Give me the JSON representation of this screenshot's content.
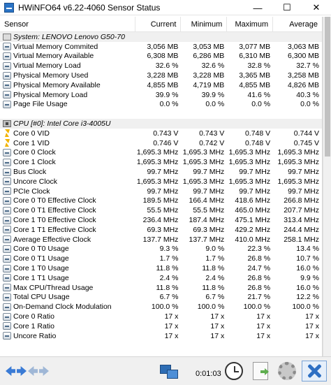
{
  "window": {
    "title": "HWiNFO64 v6.22-4060 Sensor Status",
    "controls": {
      "minimize": "—",
      "maximize": "☐",
      "close": "✕"
    }
  },
  "columns": {
    "sensor": "Sensor",
    "current": "Current",
    "minimum": "Minimum",
    "maximum": "Maximum",
    "average": "Average"
  },
  "rows": [
    {
      "type": "group",
      "icon": "system-icon",
      "label": "System: LENOVO Lenovo G50-70"
    },
    {
      "type": "data",
      "icon": "sensor-icon",
      "label": "Virtual Memory Commited",
      "cur": "3,056 MB",
      "min": "3,053 MB",
      "max": "3,077 MB",
      "avg": "3,063 MB"
    },
    {
      "type": "data",
      "icon": "sensor-icon",
      "label": "Virtual Memory Available",
      "cur": "6,308 MB",
      "min": "6,286 MB",
      "max": "6,310 MB",
      "avg": "6,300 MB"
    },
    {
      "type": "data",
      "icon": "sensor-icon",
      "label": "Virtual Memory Load",
      "cur": "32.6 %",
      "min": "32.6 %",
      "max": "32.8 %",
      "avg": "32.7 %"
    },
    {
      "type": "data",
      "icon": "sensor-icon",
      "label": "Physical Memory Used",
      "cur": "3,228 MB",
      "min": "3,228 MB",
      "max": "3,365 MB",
      "avg": "3,258 MB"
    },
    {
      "type": "data",
      "icon": "sensor-icon",
      "label": "Physical Memory Available",
      "cur": "4,855 MB",
      "min": "4,719 MB",
      "max": "4,855 MB",
      "avg": "4,826 MB"
    },
    {
      "type": "data",
      "icon": "sensor-icon",
      "label": "Physical Memory Load",
      "cur": "39.9 %",
      "min": "39.9 %",
      "max": "41.6 %",
      "avg": "40.3 %"
    },
    {
      "type": "data",
      "icon": "sensor-icon",
      "label": "Page File Usage",
      "cur": "0.0 %",
      "min": "0.0 %",
      "max": "0.0 %",
      "avg": "0.0 %"
    },
    {
      "type": "spacer"
    },
    {
      "type": "group",
      "icon": "cpu-icon",
      "label": "CPU [#0]: Intel Core i3-4005U"
    },
    {
      "type": "data",
      "icon": "voltage-icon",
      "label": "Core 0 VID",
      "cur": "0.743 V",
      "min": "0.743 V",
      "max": "0.748 V",
      "avg": "0.744 V"
    },
    {
      "type": "data",
      "icon": "voltage-icon",
      "label": "Core 1 VID",
      "cur": "0.746 V",
      "min": "0.742 V",
      "max": "0.748 V",
      "avg": "0.745 V"
    },
    {
      "type": "data",
      "icon": "sensor-icon",
      "label": "Core 0 Clock",
      "cur": "1,695.3 MHz",
      "min": "1,695.3 MHz",
      "max": "1,695.3 MHz",
      "avg": "1,695.3 MHz"
    },
    {
      "type": "data",
      "icon": "sensor-icon",
      "label": "Core 1 Clock",
      "cur": "1,695.3 MHz",
      "min": "1,695.3 MHz",
      "max": "1,695.3 MHz",
      "avg": "1,695.3 MHz"
    },
    {
      "type": "data",
      "icon": "sensor-icon",
      "label": "Bus Clock",
      "cur": "99.7 MHz",
      "min": "99.7 MHz",
      "max": "99.7 MHz",
      "avg": "99.7 MHz"
    },
    {
      "type": "data",
      "icon": "sensor-icon",
      "label": "Uncore Clock",
      "cur": "1,695.3 MHz",
      "min": "1,695.3 MHz",
      "max": "1,695.3 MHz",
      "avg": "1,695.3 MHz"
    },
    {
      "type": "data",
      "icon": "sensor-icon",
      "label": "PCIe Clock",
      "cur": "99.7 MHz",
      "min": "99.7 MHz",
      "max": "99.7 MHz",
      "avg": "99.7 MHz"
    },
    {
      "type": "data",
      "icon": "sensor-icon",
      "label": "Core 0 T0 Effective Clock",
      "cur": "189.5 MHz",
      "min": "166.4 MHz",
      "max": "418.6 MHz",
      "avg": "266.8 MHz"
    },
    {
      "type": "data",
      "icon": "sensor-icon",
      "label": "Core 0 T1 Effective Clock",
      "cur": "55.5 MHz",
      "min": "55.5 MHz",
      "max": "465.0 MHz",
      "avg": "207.7 MHz"
    },
    {
      "type": "data",
      "icon": "sensor-icon",
      "label": "Core 1 T0 Effective Clock",
      "cur": "236.4 MHz",
      "min": "187.4 MHz",
      "max": "475.1 MHz",
      "avg": "313.4 MHz"
    },
    {
      "type": "data",
      "icon": "sensor-icon",
      "label": "Core 1 T1 Effective Clock",
      "cur": "69.3 MHz",
      "min": "69.3 MHz",
      "max": "429.2 MHz",
      "avg": "244.4 MHz"
    },
    {
      "type": "data",
      "icon": "sensor-icon",
      "label": "Average Effective Clock",
      "cur": "137.7 MHz",
      "min": "137.7 MHz",
      "max": "410.0 MHz",
      "avg": "258.1 MHz"
    },
    {
      "type": "data",
      "icon": "sensor-icon",
      "label": "Core 0 T0 Usage",
      "cur": "9.3 %",
      "min": "9.0 %",
      "max": "22.3 %",
      "avg": "13.4 %"
    },
    {
      "type": "data",
      "icon": "sensor-icon",
      "label": "Core 0 T1 Usage",
      "cur": "1.7 %",
      "min": "1.7 %",
      "max": "26.8 %",
      "avg": "10.7 %"
    },
    {
      "type": "data",
      "icon": "sensor-icon",
      "label": "Core 1 T0 Usage",
      "cur": "11.8 %",
      "min": "11.8 %",
      "max": "24.7 %",
      "avg": "16.0 %"
    },
    {
      "type": "data",
      "icon": "sensor-icon",
      "label": "Core 1 T1 Usage",
      "cur": "2.4 %",
      "min": "2.4 %",
      "max": "26.8 %",
      "avg": "9.9 %"
    },
    {
      "type": "data",
      "icon": "sensor-icon",
      "label": "Max CPU/Thread Usage",
      "cur": "11.8 %",
      "min": "11.8 %",
      "max": "26.8 %",
      "avg": "16.0 %"
    },
    {
      "type": "data",
      "icon": "sensor-icon",
      "label": "Total CPU Usage",
      "cur": "6.7 %",
      "min": "6.7 %",
      "max": "21.7 %",
      "avg": "12.2 %"
    },
    {
      "type": "data",
      "icon": "sensor-icon",
      "label": "On-Demand Clock Modulation",
      "cur": "100.0 %",
      "min": "100.0 %",
      "max": "100.0 %",
      "avg": "100.0 %"
    },
    {
      "type": "data",
      "icon": "sensor-icon",
      "label": "Core 0 Ratio",
      "cur": "17 x",
      "min": "17 x",
      "max": "17 x",
      "avg": "17 x"
    },
    {
      "type": "data",
      "icon": "sensor-icon",
      "label": "Core 1 Ratio",
      "cur": "17 x",
      "min": "17 x",
      "max": "17 x",
      "avg": "17 x"
    },
    {
      "type": "data",
      "icon": "sensor-icon",
      "label": "Uncore Ratio",
      "cur": "17 x",
      "min": "17 x",
      "max": "17 x",
      "avg": "17 x"
    }
  ],
  "statusbar": {
    "timer": "0:01:03",
    "icons": {
      "nav": "navigate-arrows-icon",
      "network": "network-icon",
      "clock": "clock-icon",
      "report": "report-icon",
      "settings": "gear-icon",
      "close": "close-x-icon"
    }
  },
  "colors": {
    "group_row_bg": "#f0f0f0",
    "accent_blue": "#2d6fc3",
    "voltage_icon": "#f2b400"
  }
}
